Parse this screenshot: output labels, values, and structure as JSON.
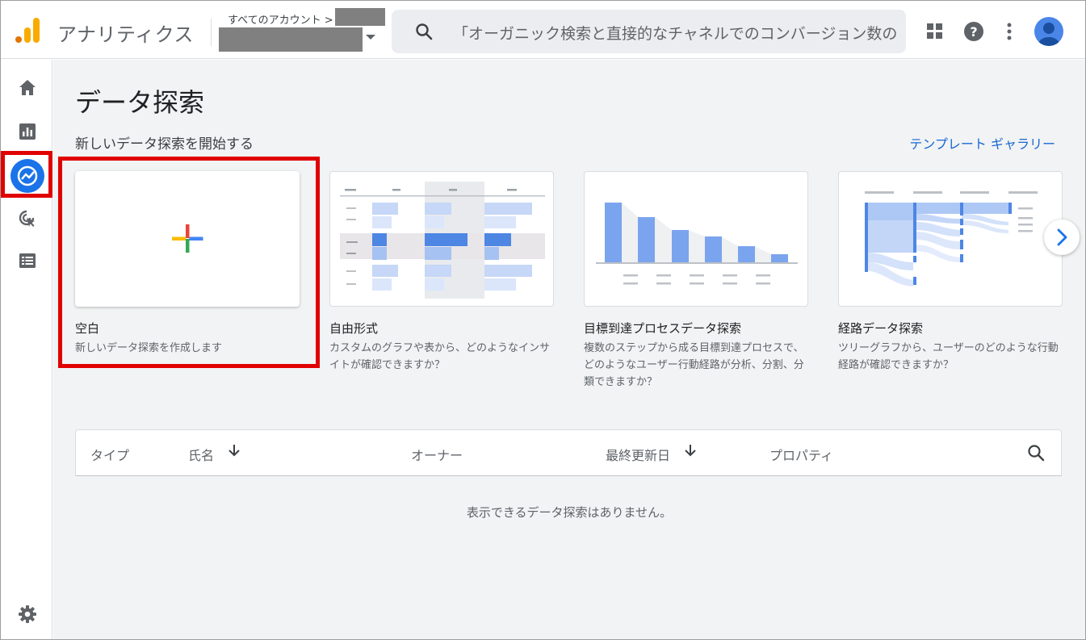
{
  "header": {
    "app_name": "アナリティクス",
    "account_crumb": "すべてのアカウント >",
    "search_placeholder": "「オーガニック検索と直接的なチャネルでのコンバージョン数の比..."
  },
  "icons": {
    "logo": "analytics-logo-icon",
    "apps": "apps-grid-icon",
    "help": "help-icon",
    "more": "more-vert-icon",
    "avatar": "account-avatar-icon"
  },
  "sidebar": {
    "items": [
      {
        "name": "home",
        "icon": "home-icon"
      },
      {
        "name": "reports",
        "icon": "bar-chart-icon"
      },
      {
        "name": "explore",
        "icon": "explore-icon",
        "active": true
      },
      {
        "name": "advertising",
        "icon": "ads-click-icon"
      },
      {
        "name": "configure",
        "icon": "list-icon"
      },
      {
        "name": "admin",
        "icon": "gear-icon"
      }
    ]
  },
  "main": {
    "page_title": "データ探索",
    "section_title": "新しいデータ探索を開始する",
    "gallery_link": "テンプレート ギャラリー",
    "cards": [
      {
        "title": "空白",
        "desc": "新しいデータ探索を作成します"
      },
      {
        "title": "自由形式",
        "desc": "カスタムのグラフや表から、どのようなインサイトが確認できますか？"
      },
      {
        "title": "目標到達プロセスデータ探索",
        "desc": "複数のステップから成る目標到達プロセスで、どのようなユーザー行動経路が分析、分割、分類できますか？"
      },
      {
        "title": "経路データ探索",
        "desc": "ツリーグラフから、ユーザーのどのような行動経路が確認できますか？"
      }
    ],
    "table": {
      "columns": [
        "タイプ",
        "氏名",
        "オーナー",
        "最終更新日",
        "プロパティ"
      ],
      "empty_message": "表示できるデータ探索はありません。"
    }
  },
  "colors": {
    "accent": "#1a73e8",
    "highlight": "#e00000",
    "logo_orange": "#f9ab00",
    "logo_dark_orange": "#e37400"
  }
}
